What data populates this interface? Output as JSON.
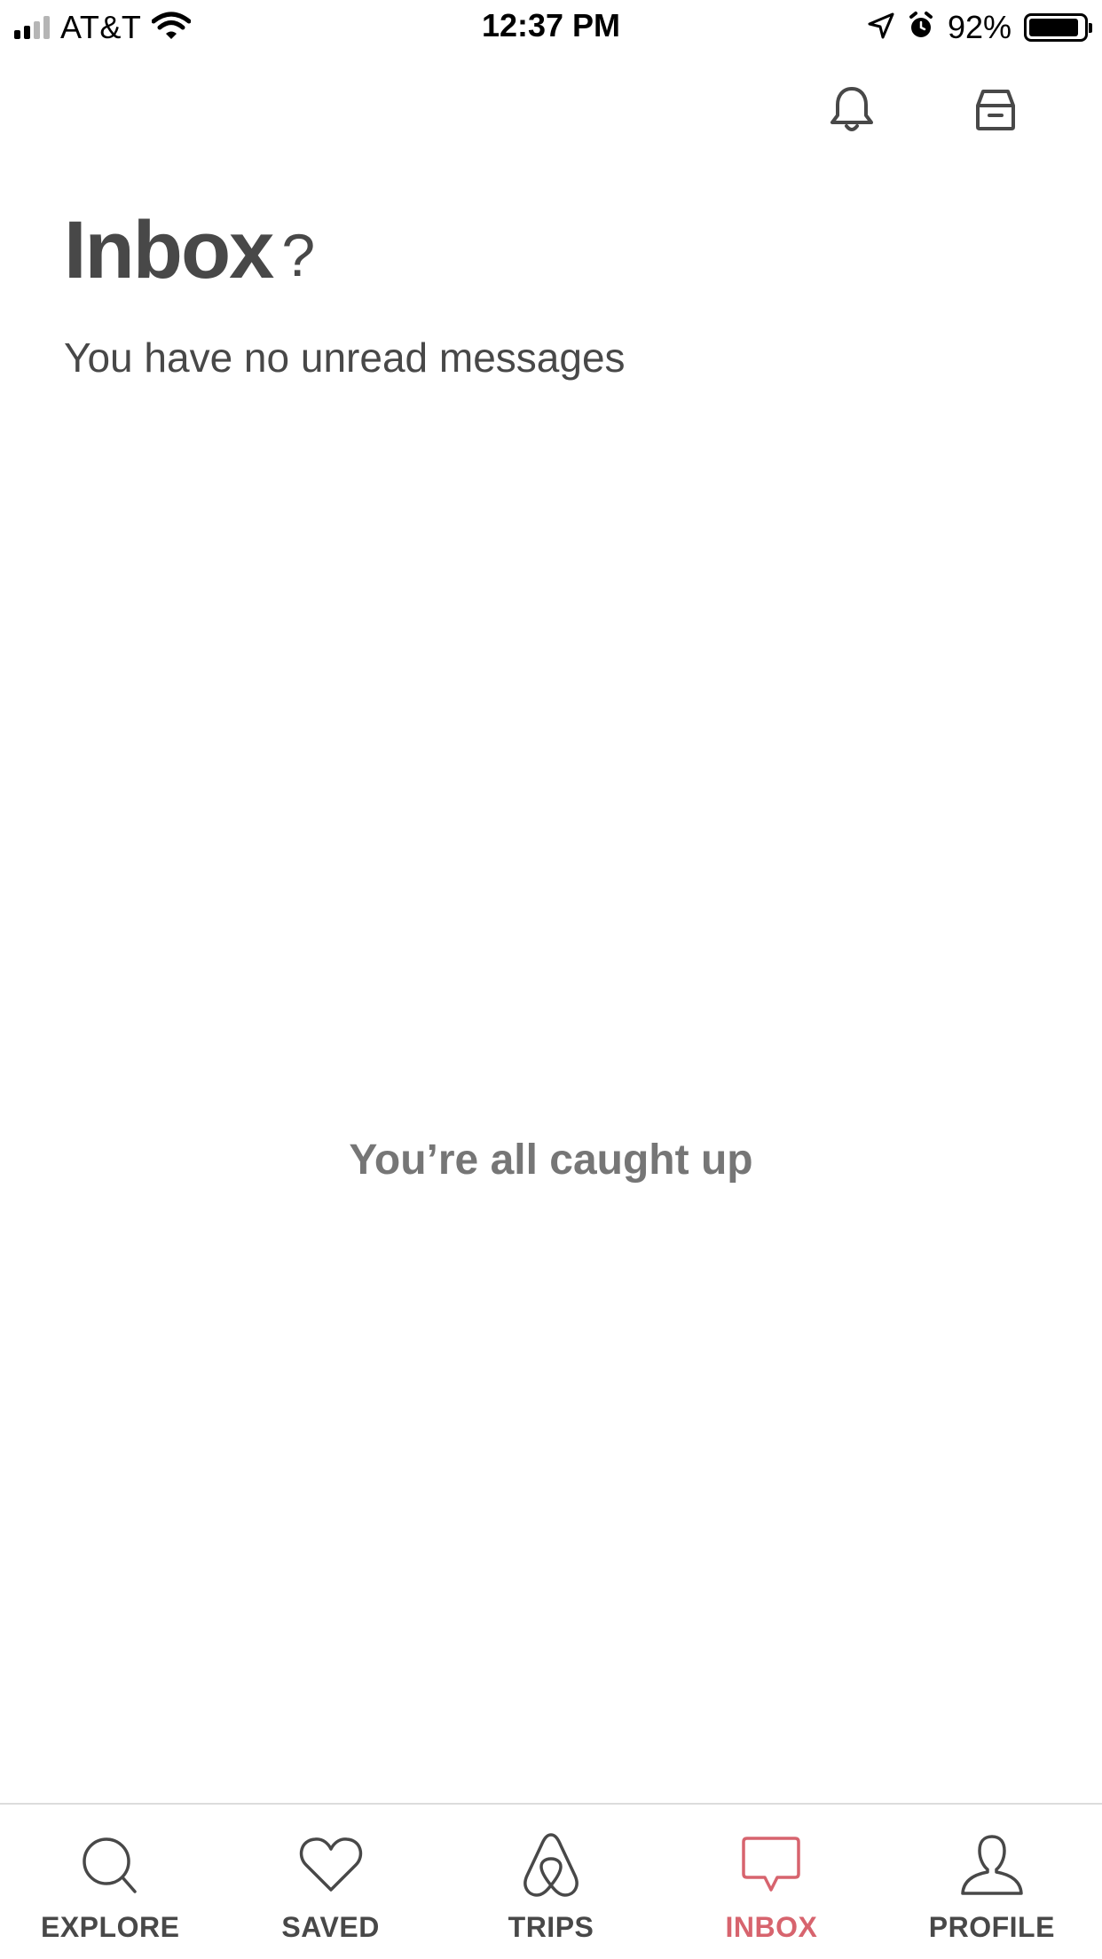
{
  "status_bar": {
    "carrier": "AT&T",
    "time": "12:37 PM",
    "battery_percent": "92%",
    "signal_bars": 2,
    "battery_level": 0.92
  },
  "header": {
    "icons": [
      "bell-icon",
      "archive-icon"
    ]
  },
  "page": {
    "title": "Inbox",
    "help": "?",
    "subtitle": "You have no unread messages",
    "empty_message": "You’re all caught up"
  },
  "tab_bar": {
    "active": "inbox",
    "active_color": "#d7646e",
    "tabs": [
      {
        "id": "explore",
        "label": "EXPLORE",
        "icon": "search-icon"
      },
      {
        "id": "saved",
        "label": "SAVED",
        "icon": "heart-icon"
      },
      {
        "id": "trips",
        "label": "TRIPS",
        "icon": "airbnb-logo-icon"
      },
      {
        "id": "inbox",
        "label": "INBOX",
        "icon": "chat-bubble-icon"
      },
      {
        "id": "profile",
        "label": "PROFILE",
        "icon": "user-icon"
      }
    ]
  }
}
